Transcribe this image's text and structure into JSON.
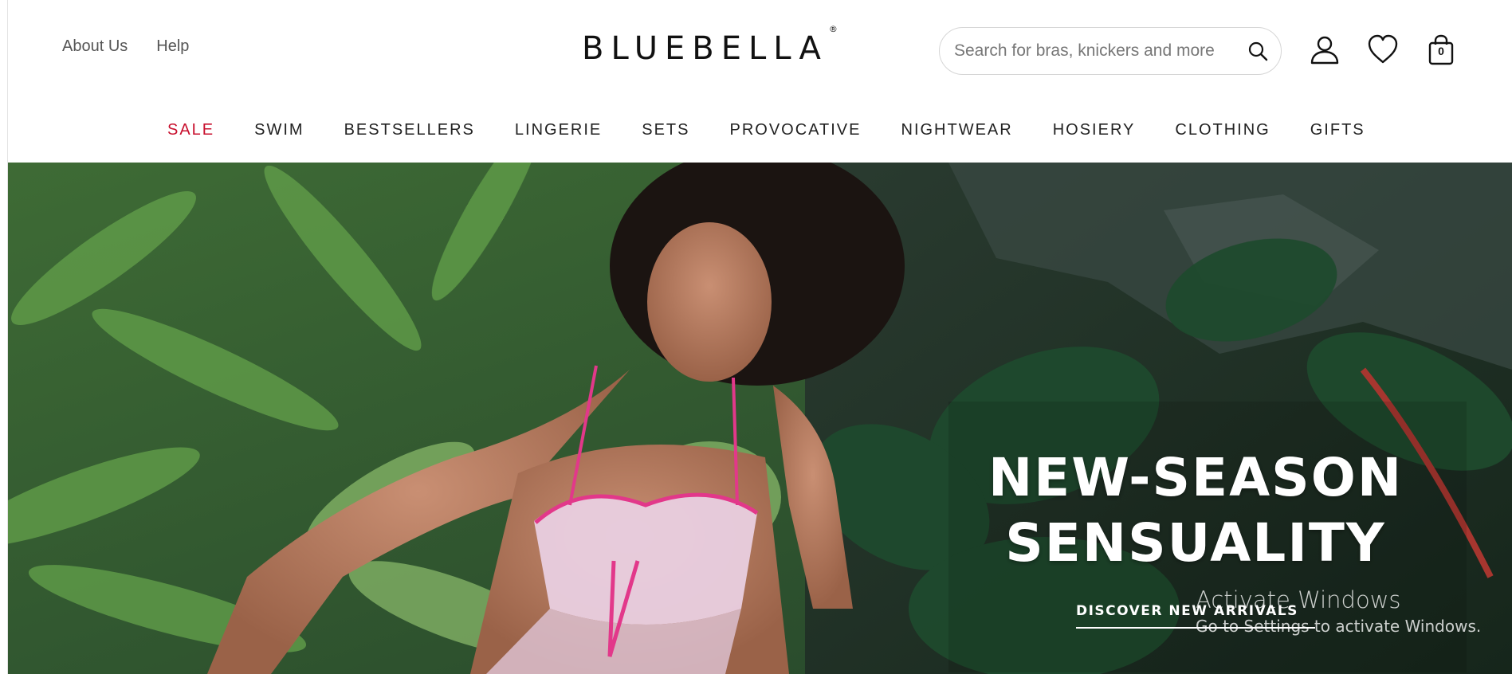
{
  "header": {
    "util_links": [
      "About Us",
      "Help"
    ],
    "logo": "BLUEBELLA",
    "logo_mark": "®",
    "search_placeholder": "Search for bras, knickers and more",
    "bag_count": "0"
  },
  "nav": {
    "items": [
      "SALE",
      "SWIM",
      "BESTSELLERS",
      "LINGERIE",
      "SETS",
      "PROVOCATIVE",
      "NIGHTWEAR",
      "HOSIERY",
      "CLOTHING",
      "GIFTS"
    ],
    "sale_color": "#c8102e"
  },
  "hero": {
    "title_line1": "NEW-SEASON",
    "title_line2": "SENSUALITY",
    "cta": "DISCOVER NEW ARRIVALS"
  },
  "os_overlay": {
    "line1": "Activate Windows",
    "line2": "Go to Settings to activate Windows."
  },
  "icons": [
    "search-icon",
    "account-icon",
    "heart-icon",
    "bag-icon"
  ]
}
